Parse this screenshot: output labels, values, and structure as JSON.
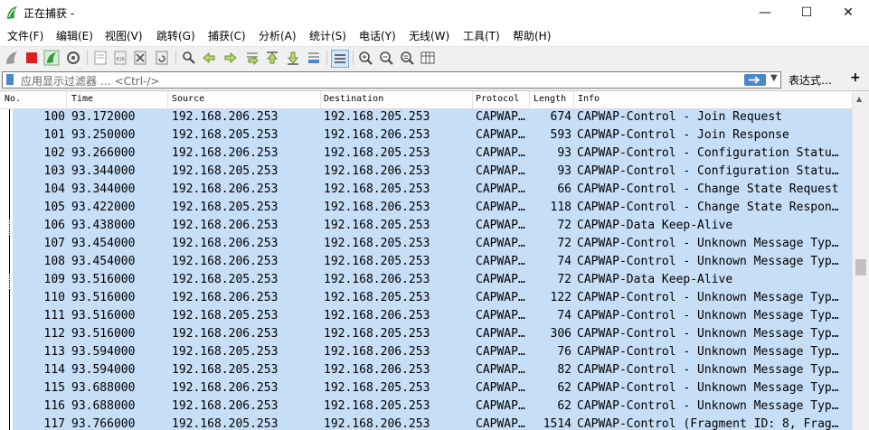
{
  "window": {
    "title": "正在捕获 -",
    "minimize_glyph": "—",
    "maximize_glyph": "☐",
    "close_glyph": "✕"
  },
  "menu": [
    "文件(F)",
    "编辑(E)",
    "视图(V)",
    "跳转(G)",
    "捕获(C)",
    "分析(A)",
    "统计(S)",
    "电话(Y)",
    "无线(W)",
    "工具(T)",
    "帮助(H)"
  ],
  "filter": {
    "placeholder": "应用显示过滤器 … <Ctrl-/>",
    "expression_label": "表达式…",
    "add_label": "+"
  },
  "columns": [
    "No.",
    "Time",
    "Source",
    "Destination",
    "Protocol",
    "Length",
    "Info"
  ],
  "packets": [
    {
      "no": "100",
      "time": "93.172000",
      "src": "192.168.206.253",
      "dst": "192.168.205.253",
      "proto": "CAPWAP…",
      "len": "674",
      "info": "CAPWAP-Control - Join Request",
      "marker": "solid"
    },
    {
      "no": "101",
      "time": "93.250000",
      "src": "192.168.205.253",
      "dst": "192.168.206.253",
      "proto": "CAPWAP…",
      "len": "593",
      "info": "CAPWAP-Control - Join Response",
      "marker": "solid"
    },
    {
      "no": "102",
      "time": "93.266000",
      "src": "192.168.206.253",
      "dst": "192.168.205.253",
      "proto": "CAPWAP…",
      "len": "93",
      "info": "CAPWAP-Control - Configuration Statu…",
      "marker": "solid"
    },
    {
      "no": "103",
      "time": "93.344000",
      "src": "192.168.205.253",
      "dst": "192.168.206.253",
      "proto": "CAPWAP…",
      "len": "93",
      "info": "CAPWAP-Control - Configuration Statu…",
      "marker": "solid"
    },
    {
      "no": "104",
      "time": "93.344000",
      "src": "192.168.206.253",
      "dst": "192.168.205.253",
      "proto": "CAPWAP…",
      "len": "66",
      "info": "CAPWAP-Control - Change State Request",
      "marker": "solid"
    },
    {
      "no": "105",
      "time": "93.422000",
      "src": "192.168.205.253",
      "dst": "192.168.206.253",
      "proto": "CAPWAP…",
      "len": "118",
      "info": "CAPWAP-Control - Change State Respon…",
      "marker": "solid"
    },
    {
      "no": "106",
      "time": "93.438000",
      "src": "192.168.206.253",
      "dst": "192.168.205.253",
      "proto": "CAPWAP…",
      "len": "72",
      "info": "CAPWAP-Data Keep-Alive",
      "marker": "dotted"
    },
    {
      "no": "107",
      "time": "93.454000",
      "src": "192.168.206.253",
      "dst": "192.168.205.253",
      "proto": "CAPWAP…",
      "len": "72",
      "info": "CAPWAP-Control - Unknown Message Typ…",
      "marker": "solid"
    },
    {
      "no": "108",
      "time": "93.454000",
      "src": "192.168.206.253",
      "dst": "192.168.205.253",
      "proto": "CAPWAP…",
      "len": "74",
      "info": "CAPWAP-Control - Unknown Message Typ…",
      "marker": "solid"
    },
    {
      "no": "109",
      "time": "93.516000",
      "src": "192.168.205.253",
      "dst": "192.168.206.253",
      "proto": "CAPWAP…",
      "len": "72",
      "info": "CAPWAP-Data Keep-Alive",
      "marker": "dotted"
    },
    {
      "no": "110",
      "time": "93.516000",
      "src": "192.168.206.253",
      "dst": "192.168.205.253",
      "proto": "CAPWAP…",
      "len": "122",
      "info": "CAPWAP-Control - Unknown Message Typ…",
      "marker": "solid"
    },
    {
      "no": "111",
      "time": "93.516000",
      "src": "192.168.205.253",
      "dst": "192.168.206.253",
      "proto": "CAPWAP…",
      "len": "74",
      "info": "CAPWAP-Control - Unknown Message Typ…",
      "marker": "solid"
    },
    {
      "no": "112",
      "time": "93.516000",
      "src": "192.168.206.253",
      "dst": "192.168.205.253",
      "proto": "CAPWAP…",
      "len": "306",
      "info": "CAPWAP-Control - Unknown Message Typ…",
      "marker": "solid"
    },
    {
      "no": "113",
      "time": "93.594000",
      "src": "192.168.205.253",
      "dst": "192.168.206.253",
      "proto": "CAPWAP…",
      "len": "76",
      "info": "CAPWAP-Control - Unknown Message Typ…",
      "marker": "solid"
    },
    {
      "no": "114",
      "time": "93.594000",
      "src": "192.168.205.253",
      "dst": "192.168.206.253",
      "proto": "CAPWAP…",
      "len": "82",
      "info": "CAPWAP-Control - Unknown Message Typ…",
      "marker": "solid"
    },
    {
      "no": "115",
      "time": "93.688000",
      "src": "192.168.206.253",
      "dst": "192.168.205.253",
      "proto": "CAPWAP…",
      "len": "62",
      "info": "CAPWAP-Control - Unknown Message Typ…",
      "marker": "solid"
    },
    {
      "no": "116",
      "time": "93.688000",
      "src": "192.168.206.253",
      "dst": "192.168.205.253",
      "proto": "CAPWAP…",
      "len": "62",
      "info": "CAPWAP-Control - Unknown Message Typ…",
      "marker": "solid"
    },
    {
      "no": "117",
      "time": "93.766000",
      "src": "192.168.205.253",
      "dst": "192.168.206.253",
      "proto": "CAPWAP…",
      "len": "1514",
      "info": "CAPWAP-Control (Fragment ID: 8, Frag…",
      "marker": "solid"
    }
  ],
  "colors": {
    "row_background": "#c7def7",
    "accent_blue": "#4a86c8",
    "stop_red": "#e02020",
    "shark_green": "#2e9c3a"
  },
  "toolbar_icons": [
    "start-capture-icon",
    "stop-capture-icon",
    "restart-capture-icon",
    "capture-options-icon",
    "open-file-icon",
    "save-file-icon",
    "close-file-icon",
    "reload-file-icon",
    "find-packet-icon",
    "go-back-icon",
    "go-forward-icon",
    "go-to-packet-icon",
    "go-first-icon",
    "go-last-icon",
    "auto-scroll-icon",
    "colorize-icon",
    "zoom-in-icon",
    "zoom-out-icon",
    "zoom-normal-icon",
    "resize-columns-icon"
  ]
}
